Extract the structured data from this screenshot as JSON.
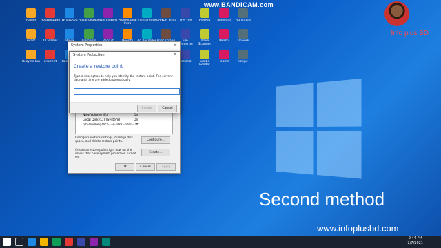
{
  "watermark": {
    "recorder": "www.BANDICAM.com"
  },
  "channel": {
    "name": "Info plus BD"
  },
  "overlay": {
    "title": "Second method",
    "url": "www.infoplusbd.com"
  },
  "taskbar": {
    "time": "9:44 PM",
    "date": "2/7/2021"
  },
  "system_properties": {
    "title": "System Properties",
    "drives": [
      {
        "name": "New Volume (E:)",
        "status": "On"
      },
      {
        "name": "Local Disk (C:) (System)",
        "status": "On"
      },
      {
        "name": "\\\\?\\Volume{2bcb32e-0000-0000-",
        "status": "Off"
      }
    ],
    "configure_text": "Configure restore settings, manage disk space, and delete restore points.",
    "configure_label": "Configure...",
    "create_text": "Create a restore point right now for the drives that have system protection turned on.",
    "create_label": "Create...",
    "ok_label": "OK",
    "cancel_label": "Cancel",
    "apply_label": "Apply"
  },
  "dialog": {
    "title": "System Protection",
    "heading": "Create a restore point",
    "description": "Type a description to help you identify the restore point. The current date and time are added automatically.",
    "input_value": "",
    "create_label": "Create",
    "cancel_label": "Cancel"
  },
  "desktop_icons": [
    "Hakim",
    "Hodwbjdgwy",
    "WhatsApp",
    "AdvancedSon",
    "Win Flowlrg",
    "Promotional Intro",
    "Vietnamese",
    "CANON Print",
    "TFM File",
    "HeyPsd",
    "Software",
    "Agriclture",
    "Avast",
    "CCleaner",
    "eBook",
    "Elements",
    "Recruit",
    "Hoenty",
    "Ad Recorder",
    "Print screen",
    "File Converter",
    "Wave Scanner",
    "Bkash",
    "Upwork",
    "Recycle Bin",
    "uTorrent",
    "Bandicam",
    "Google Chrome",
    "Zoom",
    "Unified",
    "Sport Image",
    "CorelDraw",
    "FileZilla",
    "Adobe Reader",
    "Teams",
    "Skype"
  ]
}
